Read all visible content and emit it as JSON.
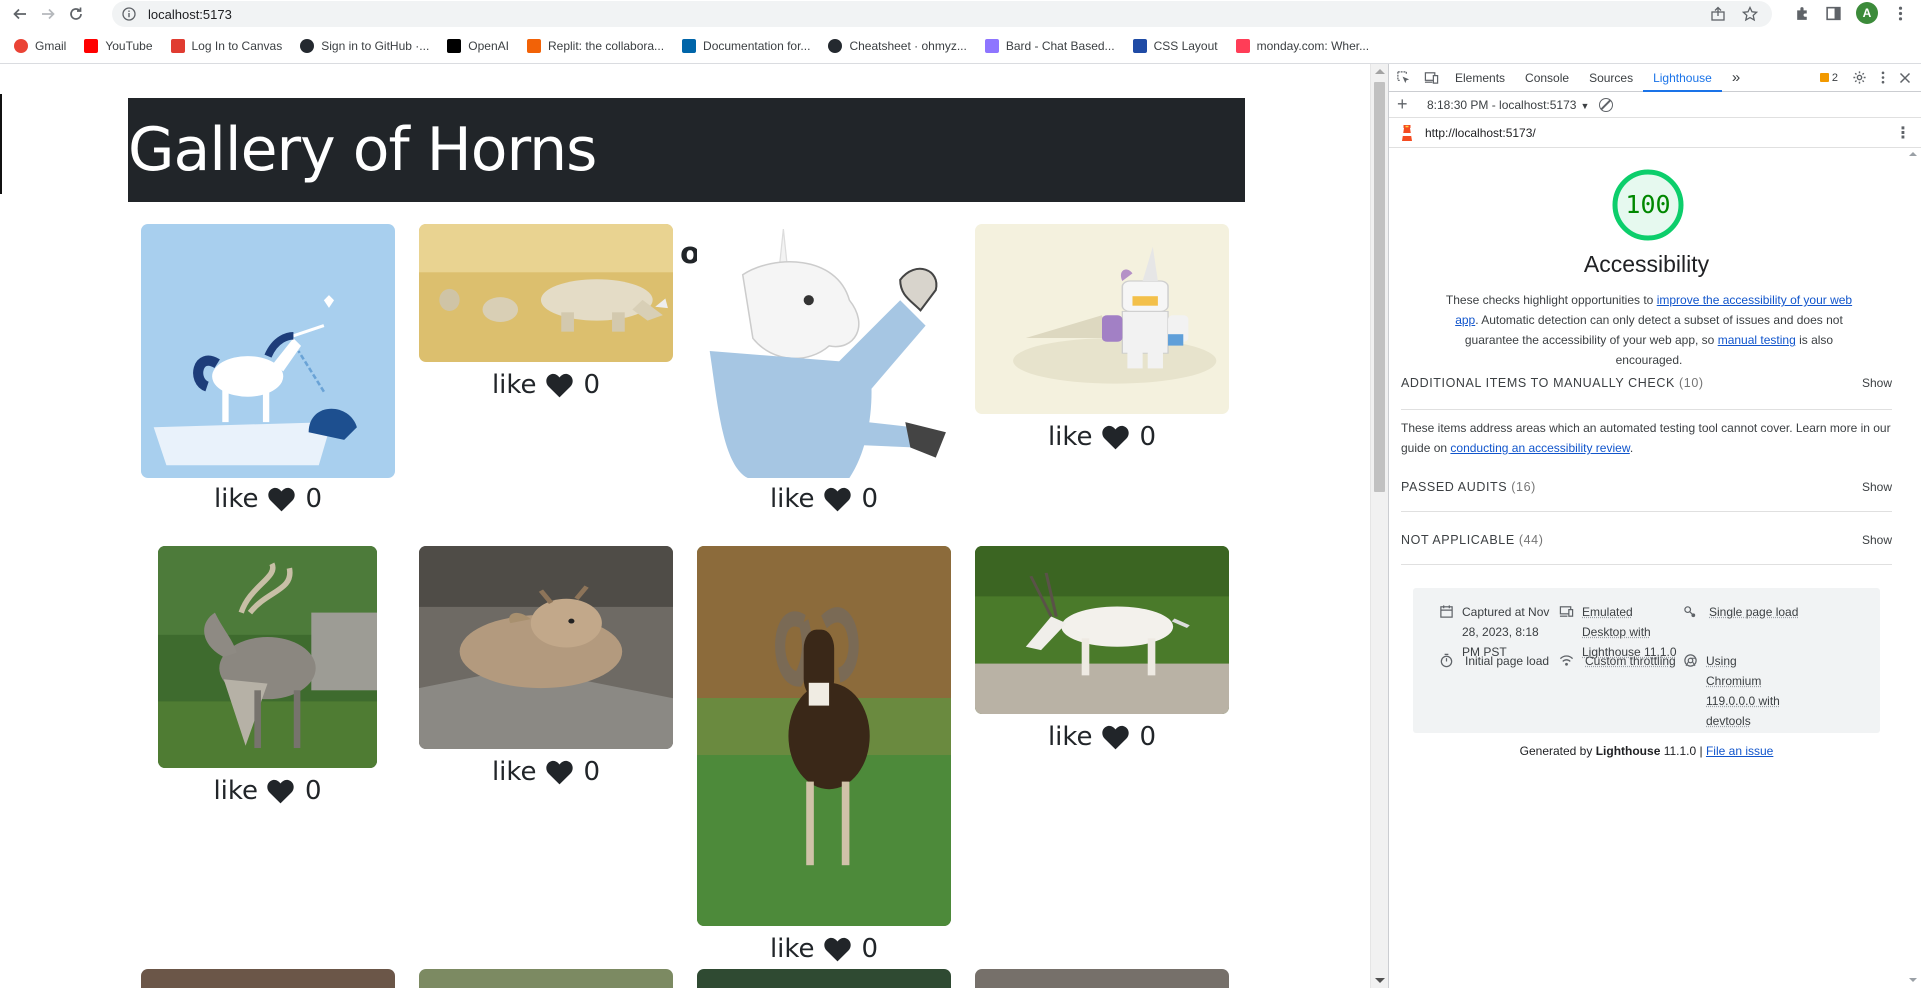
{
  "browser": {
    "url": "localhost:5173",
    "bookmarks": [
      {
        "label": "Gmail",
        "color": "#ea4335"
      },
      {
        "label": "YouTube",
        "color": "#ff0000"
      },
      {
        "label": "Log In to Canvas",
        "color": "#e03c31"
      },
      {
        "label": "Sign in to GitHub ·...",
        "color": "#24292f"
      },
      {
        "label": "OpenAI",
        "color": "#000000"
      },
      {
        "label": "Replit: the collabora...",
        "color": "#f26207"
      },
      {
        "label": "Documentation for...",
        "color": "#0065a9"
      },
      {
        "label": "Cheatsheet · ohmyz...",
        "color": "#24292f"
      },
      {
        "label": "Bard - Chat Based...",
        "color": "#8e75ff"
      },
      {
        "label": "CSS Layout",
        "color": "#1f4ba5"
      },
      {
        "label": "monday.com: Wher...",
        "color": "#ff3d57"
      }
    ],
    "avatar_letter": "A"
  },
  "page": {
    "header_title": "Gallery of Horns",
    "subtitle": "Gallery of Horns",
    "like_label": "like",
    "cards": [
      {
        "animal": "unicorn-and-narwhal",
        "likes": "0"
      },
      {
        "animal": "rhino-family",
        "likes": "0"
      },
      {
        "animal": "unicorn-head",
        "likes": "0"
      },
      {
        "animal": "unicorn-lego",
        "likes": "0"
      },
      {
        "animal": "markhor",
        "likes": "0"
      },
      {
        "animal": "baby-goat",
        "likes": "0"
      },
      {
        "animal": "mouflon",
        "likes": "0"
      },
      {
        "animal": "addax",
        "likes": "0"
      }
    ]
  },
  "devtools": {
    "tabs": [
      "Elements",
      "Console",
      "Sources",
      "Lighthouse"
    ],
    "active_tab": "Lighthouse",
    "more_tabs": "»",
    "issues_count": "2",
    "report_time": "8:18:30 PM - localhost:5173",
    "report_url": "http://localhost:5173/",
    "score": "100",
    "score_color": "#0cce6b",
    "category": "Accessibility",
    "desc_before": "These checks highlight opportunities to ",
    "desc_link1": "improve the accessibility of your web app",
    "desc_mid": ". Automatic detection can only detect a subset of issues and does not guarantee the accessibility of your web app, so ",
    "desc_link2": "manual testing",
    "desc_after": " is also encouraged.",
    "groups": [
      {
        "title": "ADDITIONAL ITEMS TO MANUALLY CHECK",
        "count": "(10)",
        "show": "Show"
      },
      {
        "title": "PASSED AUDITS",
        "count": "(16)",
        "show": "Show"
      },
      {
        "title": "NOT APPLICABLE",
        "count": "(44)",
        "show": "Show"
      }
    ],
    "manual_desc_before": "These items address areas which an automated testing tool cannot cover. Learn more in our guide on ",
    "manual_desc_link": "conducting an accessibility review",
    "manual_desc_after": ".",
    "env": {
      "captured": "Captured at Nov 28, 2023, 8:18 PM PST",
      "device": "Emulated Desktop with Lighthouse 11.1.0",
      "load": "Single page load",
      "initial": "Initial page load",
      "throttling": "Custom throttling",
      "chromium": "Using Chromium 119.0.0.0 with devtools"
    },
    "footer_prefix": "Generated by ",
    "footer_brand": "Lighthouse",
    "footer_version": " 11.1.0 | ",
    "footer_link": "File an issue"
  }
}
